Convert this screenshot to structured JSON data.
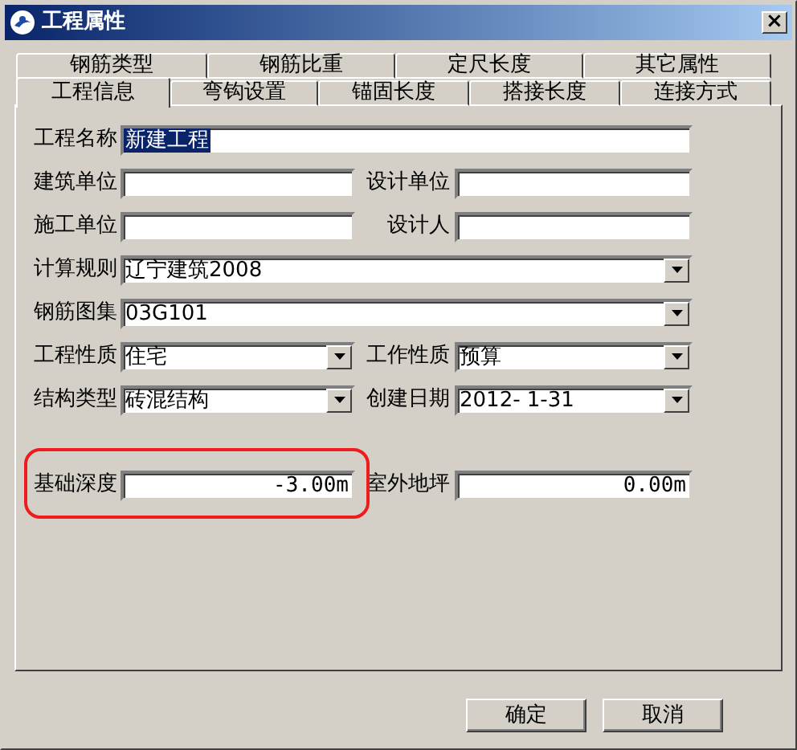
{
  "window": {
    "title": "工程属性",
    "close": "×"
  },
  "tab_rows": [
    [
      {
        "label": "钢筋类型",
        "selected": false
      },
      {
        "label": "钢筋比重",
        "selected": false
      },
      {
        "label": "定尺长度",
        "selected": false
      },
      {
        "label": "其它属性",
        "selected": false
      }
    ],
    [
      {
        "label": "工程信息",
        "selected": true
      },
      {
        "label": "弯钩设置",
        "selected": false
      },
      {
        "label": "锚固长度",
        "selected": false
      },
      {
        "label": "搭接长度",
        "selected": false
      },
      {
        "label": "连接方式",
        "selected": false
      }
    ]
  ],
  "form_rows": [
    {
      "fields": [
        {
          "label": "工程名称",
          "kind": "text",
          "value": "新建工程",
          "wide": true,
          "text_selected": true
        }
      ]
    },
    {
      "fields": [
        {
          "label": "建筑单位",
          "kind": "text"
        },
        {
          "label": "设计单位",
          "kind": "text"
        }
      ]
    },
    {
      "fields": [
        {
          "label": "施工单位",
          "kind": "text"
        },
        {
          "label": "设计人",
          "kind": "text"
        }
      ]
    },
    {
      "fields": [
        {
          "label": "计算规则",
          "kind": "dropdown",
          "value": "辽宁建筑2008",
          "wide": true
        }
      ]
    },
    {
      "fields": [
        {
          "label": "钢筋图集",
          "kind": "dropdown",
          "value": "03G101",
          "wide": true
        }
      ]
    },
    {
      "fields": [
        {
          "label": "工程性质",
          "kind": "dropdown",
          "value": "住宅"
        },
        {
          "label": "工作性质",
          "kind": "dropdown",
          "value": "预算"
        }
      ]
    },
    {
      "fields": [
        {
          "label": "结构类型",
          "kind": "dropdown",
          "value": "砖混结构"
        },
        {
          "label": "创建日期",
          "kind": "dropdown",
          "value": "2012- 1-31"
        }
      ]
    },
    {
      "gap_before": true,
      "fields": [
        {
          "label": "基础深度",
          "kind": "number",
          "value": "-3.00m",
          "highlighted": true
        },
        {
          "label": "室外地坪",
          "kind": "number",
          "value": "0.00m"
        }
      ]
    }
  ],
  "buttons": [
    "确定",
    "取消"
  ]
}
